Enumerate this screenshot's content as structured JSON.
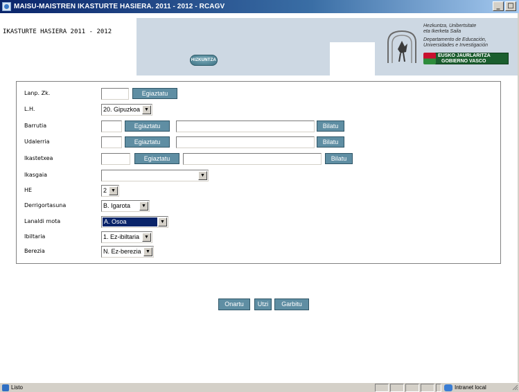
{
  "window": {
    "title": "MAISU-MAISTREN IKASTURTE HASIERA. 2011 - 2012 - RCAGV",
    "min_label": "_",
    "max_label": "□"
  },
  "header": {
    "page_title": "IKASTURTE HASIERA 2011 - 2012",
    "hizkuntza_label": "HIZKUNTZA",
    "dept_eu_line1": "Hezkuntza, Unibertsitate",
    "dept_eu_line2": "eta Ikerketa Saila",
    "dept_es_line1": "Departamento de Educación,",
    "dept_es_line2": "Universidades e Investigación",
    "gov_eu": "EUSKO JAURLARITZA",
    "gov_es": "GOBIERNO VASCO"
  },
  "form": {
    "lanp_zk": {
      "label": "Lanp. Zk.",
      "value": "",
      "button": "Egiaztatu"
    },
    "lh": {
      "label": "L.H.",
      "selected": "20. Gipuzkoa"
    },
    "barrutia": {
      "label": "Barrutia",
      "code": "",
      "button": "Egiaztatu",
      "name": "",
      "search": "Bilatu"
    },
    "udalerria": {
      "label": "Udalerria",
      "code": "",
      "button": "Egiaztatu",
      "name": "",
      "search": "Bilatu"
    },
    "ikastetxea": {
      "label": "Ikastetxea",
      "code": "",
      "button": "Egiaztatu",
      "name": "",
      "search": "Bilatu"
    },
    "ikasgaia": {
      "label": "Ikasgaia",
      "selected": ""
    },
    "he": {
      "label": "HE",
      "selected": "2"
    },
    "derrigortasuna": {
      "label": "Derrigortasuna",
      "selected": "B. Igarota"
    },
    "lanaldi_mota": {
      "label": "Lanaldi mota",
      "selected": "A. Osoa"
    },
    "ibiltaria": {
      "label": "Ibiltaria",
      "selected": "1. Ez-ibiltaria"
    },
    "berezia": {
      "label": "Berezia",
      "selected": "N. Ez-berezia"
    }
  },
  "actions": {
    "accept": "Onartu",
    "cancel": "Utzi",
    "clear": "Garbitu"
  },
  "statusbar": {
    "status": "Listo",
    "zone": "Intranet local"
  },
  "colors": {
    "title_bar": "#0a246a",
    "header_band": "#cdd8e3",
    "button_teal": "#5f8ea3",
    "selection": "#0a246a",
    "gov_green": "#1a5e2e"
  }
}
